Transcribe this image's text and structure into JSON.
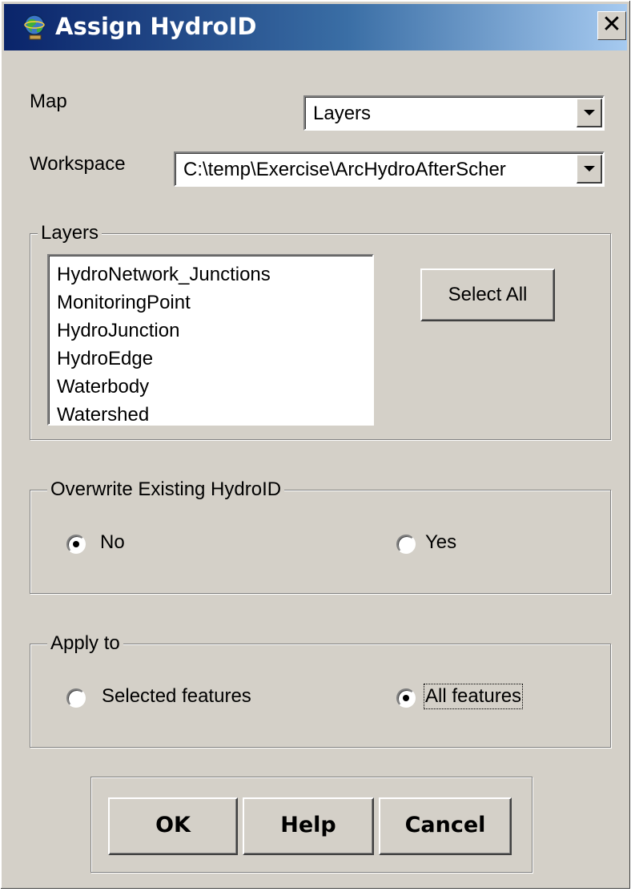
{
  "window": {
    "title": "Assign HydroID",
    "icon": "globe-icon",
    "close_symbol": "✕"
  },
  "map": {
    "label": "Map",
    "selected": "Layers"
  },
  "workspace": {
    "label": "Workspace",
    "selected": "C:\\temp\\Exercise\\ArcHydroAfterScher"
  },
  "layers_group": {
    "legend": "Layers",
    "items": [
      "HydroNetwork_Junctions",
      "MonitoringPoint",
      "HydroJunction",
      "HydroEdge",
      "Waterbody",
      "Watershed"
    ],
    "select_all_label": "Select All"
  },
  "overwrite_group": {
    "legend": "Overwrite Existing HydroID",
    "no_label": "No",
    "yes_label": "Yes",
    "selected": "No"
  },
  "apply_group": {
    "legend": "Apply to",
    "selected_features_label": "Selected features",
    "all_features_label": "All features",
    "selected": "All features"
  },
  "buttons": {
    "ok": "OK",
    "help": "Help",
    "cancel": "Cancel"
  }
}
